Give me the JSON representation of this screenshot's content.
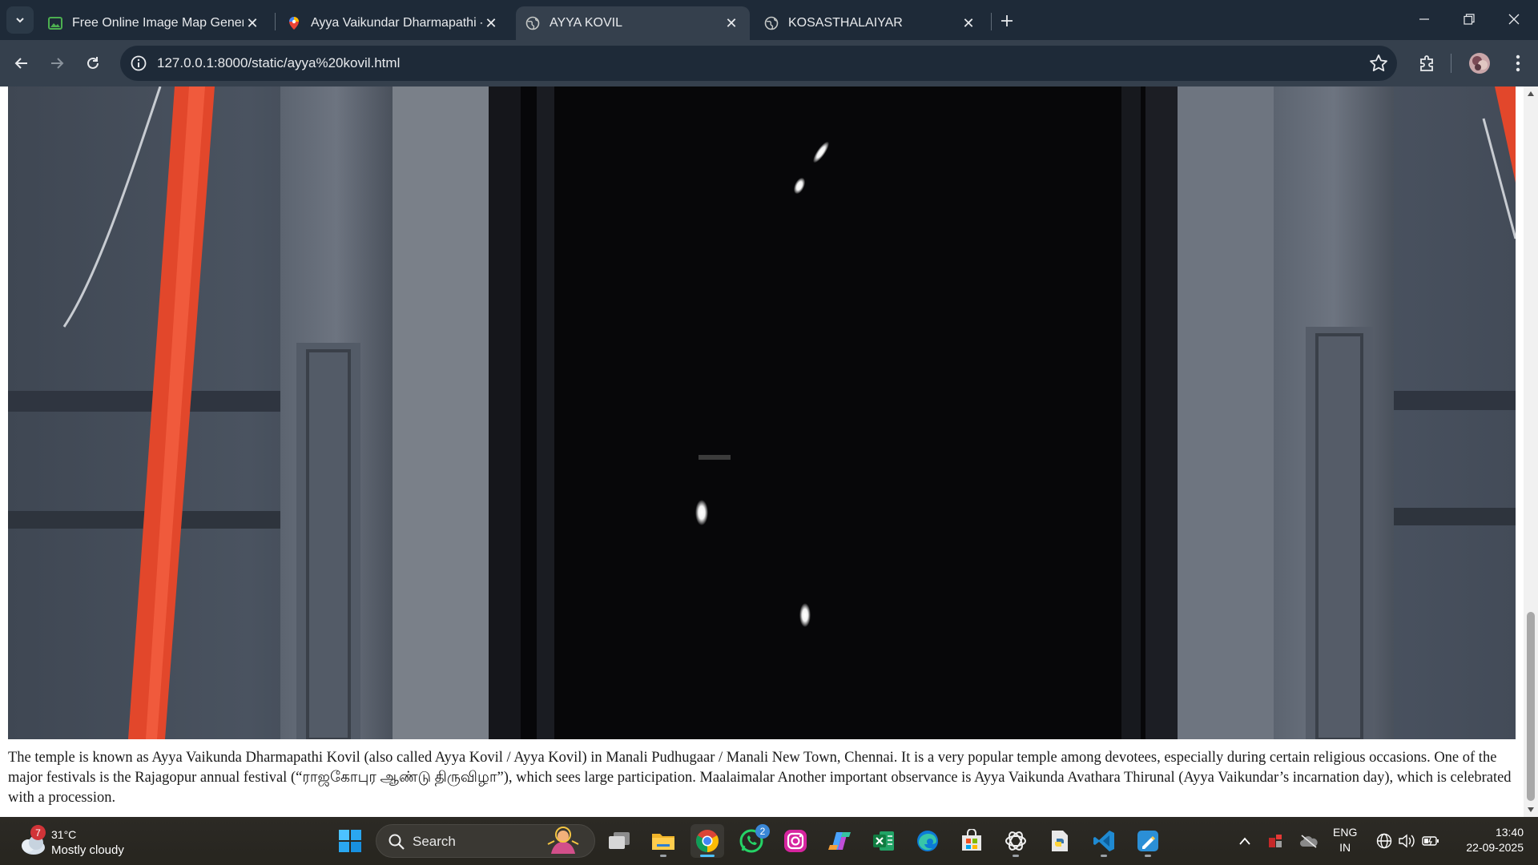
{
  "browser": {
    "tabs": [
      {
        "title": "Free Online Image Map Genera",
        "favicon": "image-map-favicon",
        "active": false
      },
      {
        "title": "Ayya Vaikundar Dharmapathi - ",
        "favicon": "google-maps-pin-favicon",
        "active": false
      },
      {
        "title": "AYYA KOVIL",
        "favicon": "globe-favicon",
        "active": true
      },
      {
        "title": "KOSASTHALAIYAR",
        "favicon": "globe-favicon",
        "active": false
      }
    ],
    "address": "127.0.0.1:8000/static/ayya%20kovil.html"
  },
  "page": {
    "image": {
      "alt_subject": "temple gopuram doorway photo",
      "accent_red": "#e2472b"
    },
    "caption": "The temple is known as Ayya Vaikunda Dharmapathi Kovil (also called Ayya Kovil / Ayya Kovil) in Manali Pudhugaar / Manali New Town, Chennai. It is a very popular temple among devotees, especially during certain religious occasions. One of the major festivals is the Rajagopur annual festival (“ராஜகோபுர ஆண்டு திருவிழா”), which sees large participation. Maalaimalar Another important observance is Ayya Vaikunda Avathara Thirunal (Ayya Vaikundar’s incarnation day), which is celebrated with a procession."
  },
  "taskbar": {
    "weather": {
      "temp": "31°C",
      "condition": "Mostly cloudy",
      "badge": "7"
    },
    "search_label": "Search",
    "whatsapp_badge": "2",
    "language": {
      "line1": "ENG",
      "line2": "IN"
    },
    "clock": {
      "time": "13:40",
      "date": "22-09-2025"
    }
  },
  "colors": {
    "tabstrip": "#1e2a38",
    "toolbar": "#35404d",
    "chrome_accent": "#4cc2ff"
  }
}
